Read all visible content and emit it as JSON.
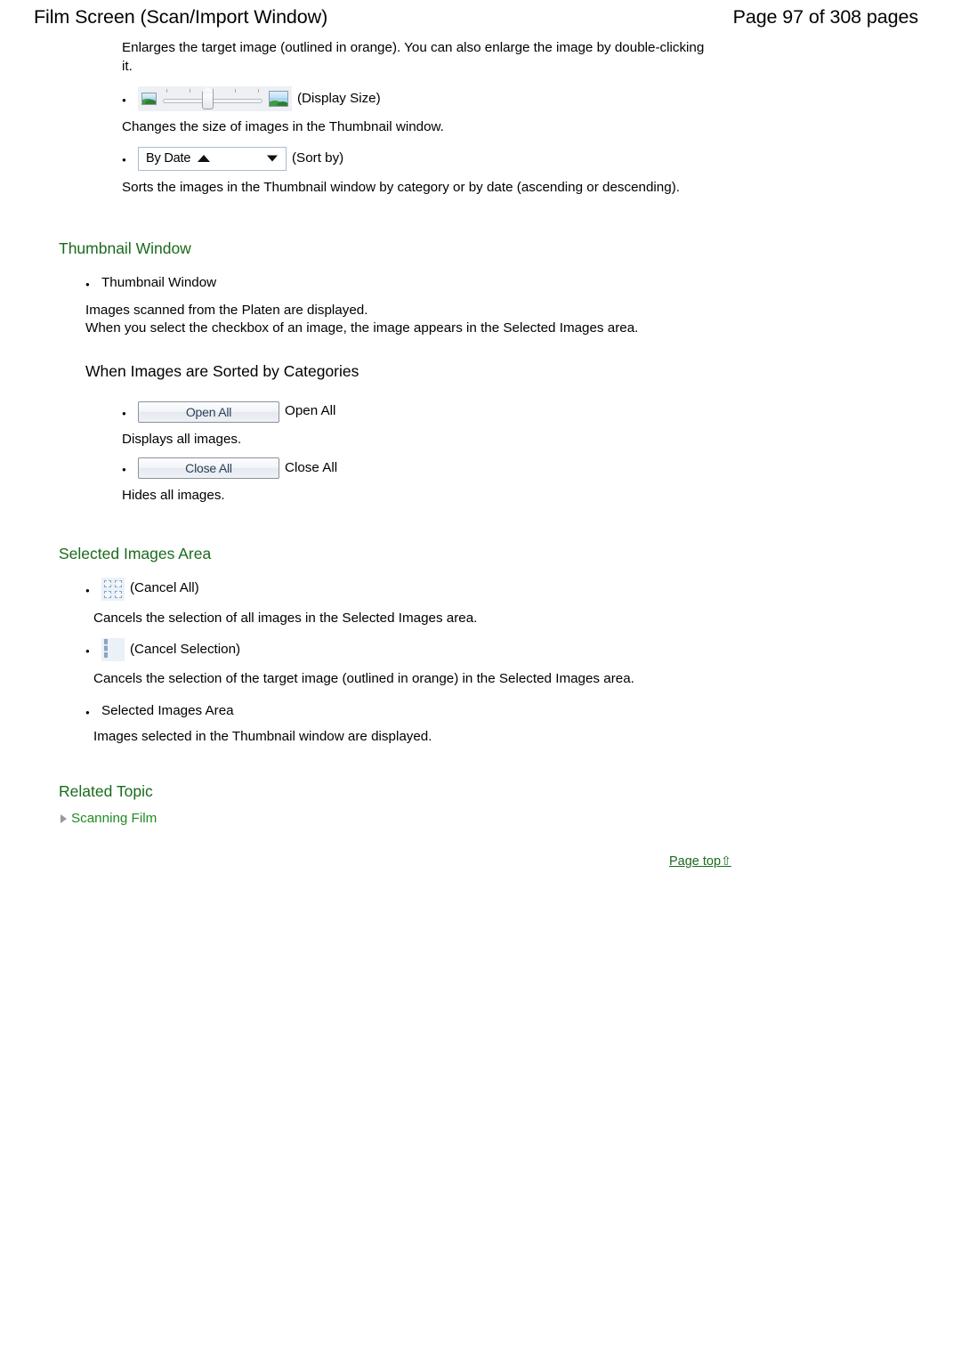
{
  "header": {
    "title": "Film Screen (Scan/Import Window)",
    "page_info": "Page 97 of 308 pages"
  },
  "colors": {
    "heading_green": "#1a6b1c",
    "link_green": "#1e8c22",
    "body_black": "#000000"
  },
  "intro": {
    "text": "Enlarges the target image (outlined in orange). You can also enlarge the image by double-clicking it."
  },
  "display_size": {
    "widget_name": "display-size-slider",
    "caption": "(Display Size)",
    "description": "Changes the size of images in the Thumbnail window.",
    "small_image_icon": "small-image-icon",
    "large_image_icon": "large-image-icon",
    "tick_count": 5
  },
  "sort_by": {
    "widget_name": "sort-by-combobox",
    "value": "By Date",
    "ascending_icon": "triangle-up-icon",
    "caret_icon": "chevron-down-icon",
    "caption": "(Sort by)",
    "description": "Sorts the images in the Thumbnail window by category or by date (ascending or descending)."
  },
  "thumbnail_window": {
    "heading": "Thumbnail Window",
    "bullet_label": "Thumbnail Window",
    "line1": "Images scanned from the Platen are displayed.",
    "line2": "When you select the checkbox of an image, the image appears in the Selected Images area.",
    "subheading": "When Images are Sorted by Categories",
    "open_all": {
      "button_label": "Open All",
      "caption": "Open All",
      "description": "Displays all images."
    },
    "close_all": {
      "button_label": "Close All",
      "caption": "Close All",
      "description": "Hides all images."
    }
  },
  "selected_images_area": {
    "heading": "Selected Images Area",
    "cancel_all": {
      "icon": "cancel-all-icon",
      "caption": "(Cancel All)",
      "description": "Cancels the selection of all images in the Selected Images area."
    },
    "cancel_selection": {
      "icon": "cancel-selection-icon",
      "caption": "(Cancel Selection)",
      "description": "Cancels the selection of the target image (outlined in orange) in the Selected Images area."
    },
    "bullet_label": "Selected Images Area",
    "bullet_description": "Images selected in the Thumbnail window are displayed."
  },
  "related_topic": {
    "heading": "Related Topic",
    "link_label": "Scanning Film",
    "link_bullet_icon": "triangle-right-icon"
  },
  "page_top": {
    "label": "Page top",
    "arrow": "⇧",
    "icon": "arrow-up-icon"
  }
}
